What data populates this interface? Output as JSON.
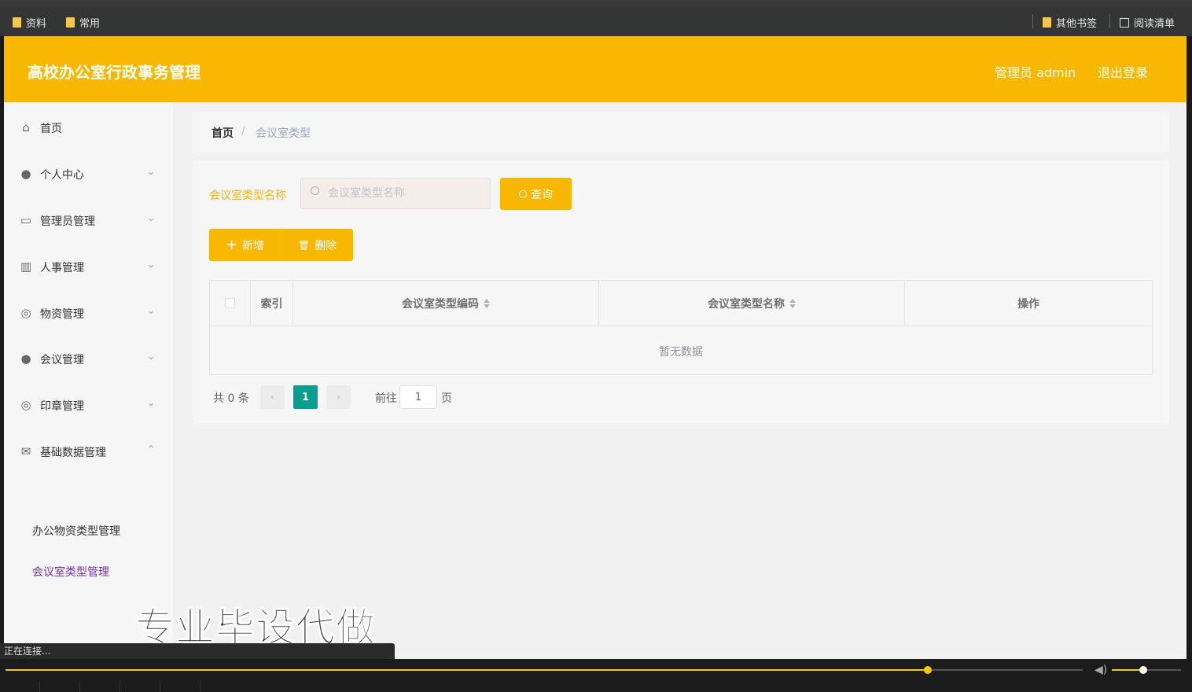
{
  "bookmarks": {
    "left": [
      {
        "label": "资料"
      },
      {
        "label": "常用"
      }
    ],
    "other": "其他书签",
    "reading_list": "阅读清单"
  },
  "header": {
    "title": "高校办公室行政事务管理",
    "admin": "管理员 admin",
    "logout": "退出登录"
  },
  "sidebar": {
    "items": [
      {
        "label": "首页",
        "icon": "home-icon"
      },
      {
        "label": "个人中心",
        "icon": "user-icon"
      },
      {
        "label": "管理员管理",
        "icon": "id-card-icon"
      },
      {
        "label": "人事管理",
        "icon": "books-icon"
      },
      {
        "label": "物资管理",
        "icon": "compass-icon"
      },
      {
        "label": "会议管理",
        "icon": "bulb-icon"
      },
      {
        "label": "印章管理",
        "icon": "gauge-icon"
      },
      {
        "label": "基础数据管理",
        "icon": "mail-icon"
      }
    ],
    "sub_items": [
      {
        "label": "办公物资类型管理",
        "active": false
      },
      {
        "label": "会议室类型管理",
        "active": true
      }
    ]
  },
  "breadcrumb": {
    "home": "首页",
    "separator": "/",
    "current": "会议室类型"
  },
  "search": {
    "label": "会议室类型名称",
    "placeholder": "会议室类型名称",
    "value": "",
    "button": "查询"
  },
  "actions": {
    "add": "新增",
    "delete": "删除"
  },
  "table": {
    "columns": [
      "索引",
      "会议室类型编码",
      "会议室类型名称",
      "操作"
    ],
    "rows": [],
    "empty_text": "暂无数据"
  },
  "pagination": {
    "total": "共 0 条",
    "current_page": "1",
    "goto_label": "前往",
    "goto_value": "1",
    "page_unit": "页"
  },
  "watermark": "专业毕设代做",
  "status": "正在连接...",
  "player": {
    "progress": 0.856,
    "volume": 0.45
  },
  "colors": {
    "accent": "#f8b700",
    "active_page": "#0b9e8e",
    "active_sub": "#7b2fb5"
  }
}
